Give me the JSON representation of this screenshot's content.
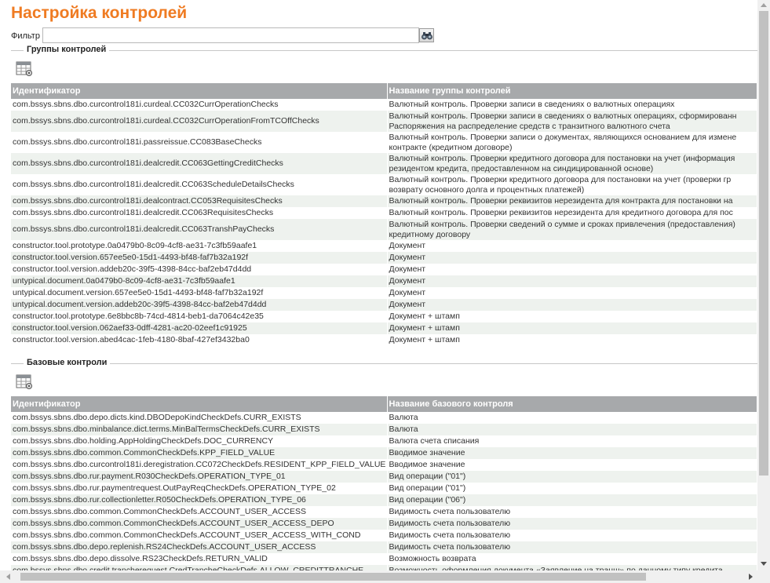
{
  "page": {
    "title": "Настройка контролей"
  },
  "filter": {
    "label": "Фильтр",
    "value": "",
    "placeholder": "",
    "button_icon": "binoculars-icon"
  },
  "groups": {
    "legend": "Группы контролей",
    "toolbar_icon": "table-settings-icon",
    "columns": [
      "Идентификатор",
      "Название группы контролей"
    ],
    "rows": [
      [
        "com.bssys.sbns.dbo.curcontrol181i.curdeal.CC032CurrOperationChecks",
        "Валютный контроль. Проверки записи в сведениях о валютных операциях"
      ],
      [
        "com.bssys.sbns.dbo.curcontrol181i.curdeal.CC032CurrOperationFromTCOffChecks",
        "Валютный контроль. Проверки записи в сведениях о валютных операциях, сформированн Распоряжения на распределение средств с транзитного валютного счета"
      ],
      [
        "com.bssys.sbns.dbo.curcontrol181i.passreissue.CC083BaseChecks",
        "Валютный контроль. Проверки записи о документах, являющихся основанием для измене контракте (кредитном договоре)"
      ],
      [
        "com.bssys.sbns.dbo.curcontrol181i.dealcredit.CC063GettingCreditChecks",
        "Валютный контроль. Проверки кредитного договора для постановки на учет (информация резидентом кредита, предоставленном на синдицированной основе)"
      ],
      [
        "com.bssys.sbns.dbo.curcontrol181i.dealcredit.CC063ScheduleDetailsChecks",
        "Валютный контроль. Проверки кредитного договора для постановки на учет (проверки гр возврату основного долга и процентных платежей)"
      ],
      [
        "com.bssys.sbns.dbo.curcontrol181i.dealcontract.CC053RequisitesChecks",
        "Валютный контроль. Проверки реквизитов нерезидента для контракта для постановки на"
      ],
      [
        "com.bssys.sbns.dbo.curcontrol181i.dealcredit.CC063RequisitesChecks",
        "Валютный контроль. Проверки реквизитов нерезидента для кредитного договора для пос"
      ],
      [
        "com.bssys.sbns.dbo.curcontrol181i.dealcredit.CC063TranshPayChecks",
        "Валютный контроль. Проверки сведений о сумме и сроках привлечения (предоставления) кредитному договору"
      ],
      [
        "constructor.tool.prototype.0a0479b0-8c09-4cf8-ae31-7c3fb59aafe1",
        "Документ"
      ],
      [
        "constructor.tool.version.657ee5e0-15d1-4493-bf48-faf7b32a192f",
        "Документ"
      ],
      [
        "constructor.tool.version.addeb20c-39f5-4398-84cc-baf2eb47d4dd",
        "Документ"
      ],
      [
        "untypical.document.0a0479b0-8c09-4cf8-ae31-7c3fb59aafe1",
        "Документ"
      ],
      [
        "untypical.document.version.657ee5e0-15d1-4493-bf48-faf7b32a192f",
        "Документ"
      ],
      [
        "untypical.document.version.addeb20c-39f5-4398-84cc-baf2eb47d4dd",
        "Документ"
      ],
      [
        "constructor.tool.prototype.6e8bbc8b-74cd-4814-beb1-da7064c42e35",
        "Документ + штамп"
      ],
      [
        "constructor.tool.version.062aef33-0dff-4281-ac20-02eef1c91925",
        "Документ + штамп"
      ],
      [
        "constructor.tool.version.abed4cac-1feb-4180-8baf-427ef3432ba0",
        "Документ + штамп"
      ]
    ]
  },
  "base": {
    "legend": "Базовые контроли",
    "toolbar_icon": "table-settings-icon",
    "columns": [
      "Идентификатор",
      "Название базового контроля"
    ],
    "rows": [
      [
        "com.bssys.sbns.dbo.depo.dicts.kind.DBODepoKindCheckDefs.CURR_EXISTS",
        "Валюта"
      ],
      [
        "com.bssys.sbns.dbo.minbalance.dict.terms.MinBalTermsCheckDefs.CURR_EXISTS",
        "Валюта"
      ],
      [
        "com.bssys.sbns.dbo.holding.AppHoldingCheckDefs.DOC_CURRENCY",
        "Валюта счета списания"
      ],
      [
        "com.bssys.sbns.dbo.common.CommonCheckDefs.KPP_FIELD_VALUE",
        "Вводимое значение"
      ],
      [
        "com.bssys.sbns.dbo.curcontrol181i.deregistration.CC072CheckDefs.RESIDENT_KPP_FIELD_VALUE",
        "Вводимое значение"
      ],
      [
        "com.bssys.sbns.dbo.rur.payment.R030CheckDefs.OPERATION_TYPE_01",
        "Вид операции (\"01\")"
      ],
      [
        "com.bssys.sbns.dbo.rur.paymentrequest.OutPayReqCheckDefs.OPERATION_TYPE_02",
        "Вид операции (\"01\")"
      ],
      [
        "com.bssys.sbns.dbo.rur.collectionletter.R050CheckDefs.OPERATION_TYPE_06",
        "Вид операции (\"06\")"
      ],
      [
        "com.bssys.sbns.dbo.common.CommonCheckDefs.ACCOUNT_USER_ACCESS",
        "Видимость счета пользователю"
      ],
      [
        "com.bssys.sbns.dbo.common.CommonCheckDefs.ACCOUNT_USER_ACCESS_DEPO",
        "Видимость счета пользователю"
      ],
      [
        "com.bssys.sbns.dbo.common.CommonCheckDefs.ACCOUNT_USER_ACCESS_WITH_COND",
        "Видимость счета пользователю"
      ],
      [
        "com.bssys.sbns.dbo.depo.replenish.RS24CheckDefs.ACCOUNT_USER_ACCESS",
        "Видимость счета пользователю"
      ],
      [
        "com.bssys.sbns.dbo.depo.dissolve.RS23CheckDefs.RETURN_VALID",
        "Возможность возврата"
      ],
      [
        "com.bssys.sbns.dbo.credit.tranchereguest.CredTrancheCheckDefs.ALLOW_CREDITTRANCHE",
        "Возможность оформления документа «Заявление на транш» по данному типу кредита"
      ]
    ]
  }
}
